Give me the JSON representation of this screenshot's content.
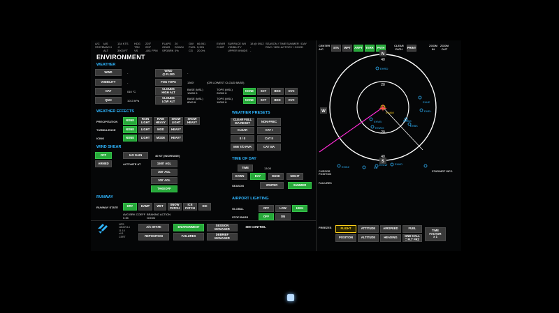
{
  "header": {
    "col1": "A/C\nSTATE",
    "col2": "IAS\nMACH\nALT",
    "col3": "134 KTS\n.2\n3903 FT",
    "col4": "HDG\nTRK\nVS",
    "col5": "225°\n225°\n-841 FPM",
    "col6": "FLAPS\nGEAR\nSPDBRK",
    "col7": "20\nDOWN\n0%",
    "col8": "GW\nFUEL\nCG",
    "col9": "66,951\n5,326\n20.0%",
    "col10": "ENVIR\nCHNT",
    "col11": "SURFACE W/I\nVISIBILITY\nUPPER WINDS",
    "col12": "18 @ 0912\n-\n-",
    "col13": "SEASON / TIME\nRWY / BRK ACT",
    "col14": "SUMMER / DAY\nDRY / GOOD"
  },
  "page_title": "ENVIRONMENT",
  "weather": {
    "section": "WEATHER",
    "wind": "WIND",
    "wind_val": "-",
    "wind_fl": "WIND\n@ FL300",
    "wind_fl_val": "-",
    "visibility": "VISIBILITY",
    "visibility_val": "-",
    "fog_tops": "FOG TOPS",
    "fog_tops_val": "1300'",
    "fog_note": "(OR LOWEST CLOUD BASE)",
    "oat": "OAT",
    "oat_val": "010 °C",
    "clouds_high": "CLOUDS\nHIGH ALT",
    "clouds_high_base": "BASE (MSL)\n10000 ft",
    "clouds_high_tops": "TOPS (MSL)\n20000 ft",
    "qnh": "QNH",
    "qnh_val": "1013 hPa",
    "clouds_low": "CLOUDS\nLOW ALT",
    "clouds_low_base": "BASE (MSL)\n8000 ft",
    "clouds_low_tops": "TOPS (MSL)\n10000 ft",
    "cloud_opts": [
      "NONE",
      "SCT",
      "BKN",
      "OVC"
    ]
  },
  "effects": {
    "section": "WEATHER EFFECTS",
    "precip": "PRECIPITATION",
    "precip_opts": [
      "NONE",
      "RAIN\nLIGHT",
      "RAIN\nHEAVY",
      "SNOW\nLIGHT",
      "SNOW\nHEAVY"
    ],
    "turb": "TURBULENCE",
    "turb_opts": [
      "NONE",
      "LIGHT",
      "MOD",
      "HEAVY"
    ],
    "icing": "ICING",
    "icing_opts": [
      "NONE",
      "LIGHT",
      "MODE",
      "HEAVY"
    ]
  },
  "shear": {
    "section": "WIND SHEAR",
    "off": "OFF",
    "armed": "ARMED",
    "ias_gain": "IAS GAIN",
    "ias_gain_val": "40 KT (INCREASE)",
    "activate_at": "ACTIVATE AT",
    "alts": [
      "1500' AGL",
      "300' AGL",
      "100' AGL"
    ],
    "takeoff": "TAKEOFF"
  },
  "presets": {
    "section": "WEATHER PRESETS",
    "items": [
      "CLEAR FULL\nISA RESET",
      "NON-PREC",
      "CLEAR",
      "CAT I",
      "0 / 0",
      "CAT II",
      "MIN T/O RVR",
      "CAT IIIA"
    ]
  },
  "time_of_day": {
    "section": "TIME OF DAY",
    "time": "TIME",
    "time_val": "13:00",
    "opts": [
      "DAWN",
      "DAY",
      "DUSK",
      "NIGHT"
    ],
    "season": "SEASON",
    "season_opts": [
      "WINTER",
      "SUMMER"
    ]
  },
  "runway": {
    "section": "RUNWAY",
    "state": "RUNWAY STATE",
    "opts": [
      "DRY",
      "DAMP",
      "WET",
      "SNOW\nPATCH",
      "ICE\nPATCH",
      "ICE"
    ],
    "avg_coef": "AVG BRK COEFF\n0.35",
    "braking": "BRAKING ACTION\nGOOD"
  },
  "lighting": {
    "section": "AIRPORT LIGHTING",
    "global": "GLOBAL",
    "global_opts": [
      "OFF",
      "LOW",
      "HIGH"
    ],
    "stopbars": "STOP BARS",
    "stopbar_opts": [
      "OFF",
      "ON"
    ]
  },
  "nav": {
    "info": "NPS:\n18NOV14\n11:10\nv4.1\nCERT",
    "tabs": [
      "A/C STATE",
      "ENVIRONMENT",
      "SESSION\nMANAGER",
      "SIM CONTROL",
      "REPOSITION",
      "FAILURES",
      "DEBRIEF\nMANAGER"
    ]
  },
  "map_toolbar": {
    "items": [
      "CENTER\nA/C",
      "STA",
      "WPT",
      "ARPT",
      "TERR",
      "PATH",
      "CLEAR\nPATH",
      "PRINT",
      "ZOOM\nIN",
      "ZOOM\nOUT"
    ]
  },
  "map": {
    "north": "N",
    "west": "W",
    "south": "S",
    "ring_labels": [
      "40",
      "20",
      "20",
      "40"
    ],
    "fixes": [
      "EHRD",
      "EHLE",
      "EHAM",
      "EHVB",
      "EHV",
      "EHGG",
      "EHEL",
      "EHBK",
      "EHWO",
      "EHNZ",
      "EHLW",
      "EHKD",
      "EHSB",
      "EHWE",
      "EB"
    ],
    "cursor_pos": "CURSOR\nPOSITION",
    "starmrt": "STAR/MRT INFO",
    "failures": "FAILURES"
  },
  "freezes": {
    "label": "FREEZES",
    "items": [
      "FLIGHT",
      "ATTITUDE",
      "AIRSPEED",
      "FUEL",
      "TIME\nFACTOR\nx 1",
      "POSITION",
      "ALTITUDE",
      "HEADING",
      "GND CALL\n= FLT FRZ"
    ]
  },
  "colors": {
    "accent": "#2fb6ff",
    "active": "#27a83a",
    "freeze": "#ffd11a",
    "track": "#ff2bd6"
  }
}
